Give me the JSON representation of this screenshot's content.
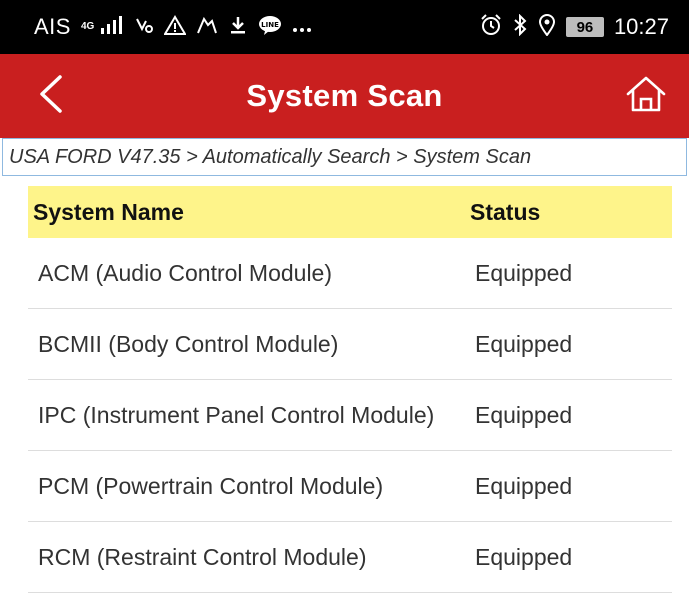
{
  "status_bar": {
    "carrier": "AIS",
    "network": "4G",
    "time": "10:27",
    "battery": "96"
  },
  "app_bar": {
    "title": "System Scan",
    "background": "#c91f1f"
  },
  "breadcrumb": "USA FORD V47.35 > Automatically Search > System Scan",
  "table": {
    "header_background": "#fef48a",
    "columns": [
      "System Name",
      "Status"
    ],
    "rows": [
      {
        "name": "ACM (Audio Control Module)",
        "status": "Equipped"
      },
      {
        "name": "BCMII (Body Control Module)",
        "status": "Equipped"
      },
      {
        "name": "IPC (Instrument Panel Control Module)",
        "status": "Equipped"
      },
      {
        "name": "PCM (Powertrain Control Module)",
        "status": "Equipped"
      },
      {
        "name": "RCM (Restraint Control Module)",
        "status": "Equipped"
      }
    ]
  },
  "icons": {
    "back": "chevron-left-icon",
    "home": "home-icon"
  }
}
